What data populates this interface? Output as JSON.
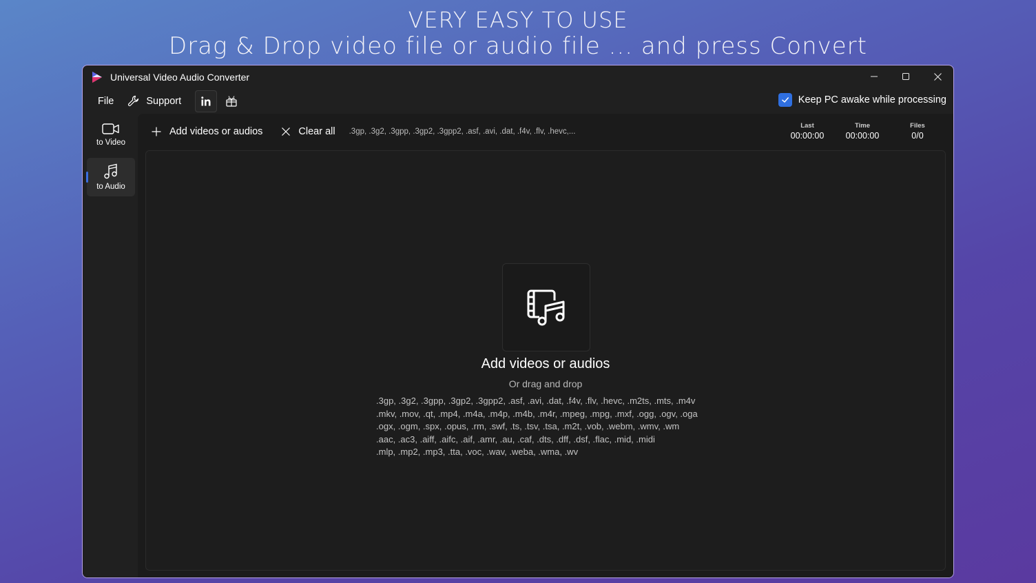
{
  "promo": {
    "line1": "VERY EASY TO USE",
    "line2": "Drag & Drop video file or audio file ... and press Convert"
  },
  "window": {
    "title": "Universal Video Audio Converter",
    "controls": [
      "minimize-icon",
      "maximize-icon",
      "close-icon"
    ]
  },
  "menu": {
    "file": "File",
    "support": "Support",
    "linkedin_icon": "linkedin-icon",
    "gift_icon": "gift-icon"
  },
  "keep_awake": {
    "label": "Keep PC awake while processing",
    "checked": true
  },
  "sidebar": {
    "items": [
      {
        "label": "to Video",
        "icon": "video-camera-icon",
        "active": false
      },
      {
        "label": "to Audio",
        "icon": "music-note-icon",
        "active": true
      }
    ]
  },
  "toolbar": {
    "add_label": "Add videos or audios",
    "clear_label": "Clear all",
    "formats_preview": ".3gp, .3g2, .3gpp, .3gp2, .3gpp2, .asf, .avi, .dat, .f4v, .flv, .hevc,..."
  },
  "stats": [
    {
      "label": "Last",
      "value": "00:00:00"
    },
    {
      "label": "Time",
      "value": "00:00:00"
    },
    {
      "label": "Files",
      "value": "0/0"
    }
  ],
  "dropzone": {
    "title": "Add videos or audios",
    "subtitle": "Or drag and drop",
    "formats_lines": [
      ".3gp, .3g2, .3gpp, .3gp2, .3gpp2, .asf, .avi, .dat, .f4v, .flv, .hevc, .m2ts, .mts, .m4v",
      ".mkv, .mov, .qt, .mp4, .m4a, .m4p, .m4b, .m4r, .mpeg, .mpg, .mxf, .ogg, .ogv, .oga",
      ".ogx, .ogm, .spx, .opus, .rm, .swf, .ts, .tsv, .tsa, .m2t, .vob, .webm, .wmv, .wm",
      ".aac, .ac3, .aiff, .aifc, .aif, .amr, .au, .caf, .dts, .dff, .dsf, .flac, .mid, .midi",
      ".mlp, .mp2, .mp3, .tta, .voc, .wav, .weba, .wma, .wv"
    ]
  },
  "colors": {
    "accent": "#2f6fe0",
    "window_bg": "#202020",
    "content_bg": "#1b1b1b"
  }
}
